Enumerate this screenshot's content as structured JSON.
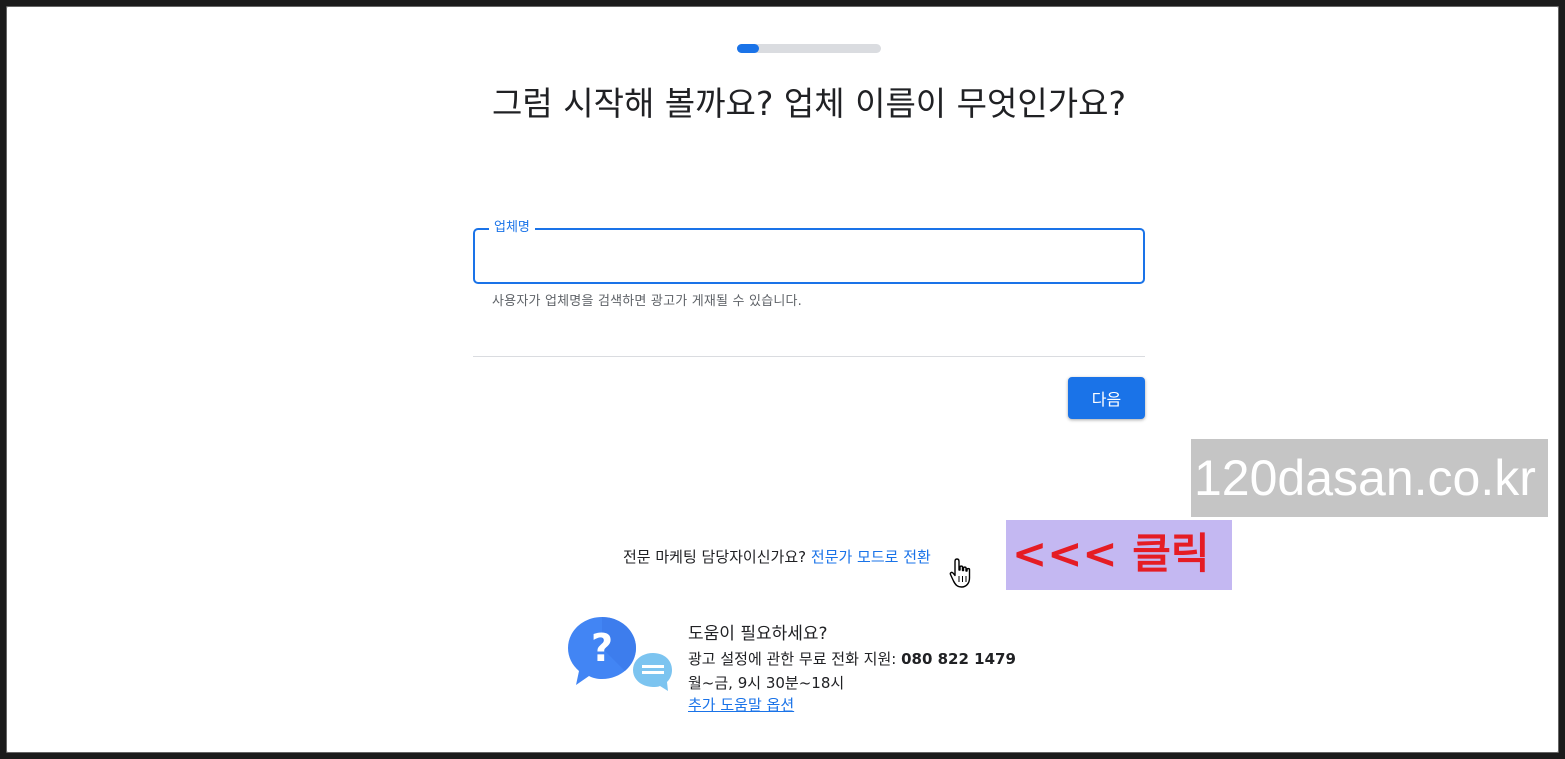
{
  "progress": {
    "fraction": 0.15
  },
  "title": "그럼 시작해 볼까요? 업체 이름이 무엇인가요?",
  "business_field": {
    "label": "업체명",
    "value": "",
    "helper": "사용자가 업체명을 검색하면 광고가 게재될 수 있습니다."
  },
  "next_button": "다음",
  "watermark": "120dasan.co.kr",
  "expert": {
    "question": "전문 마케팅 담당자이신가요?",
    "link": "전문가 모드로 전환"
  },
  "annotation": "<<< 클릭",
  "help": {
    "title": "도움이 필요하세요?",
    "phone_prefix": "광고 설정에 관한 무료 전화 지원:",
    "phone": "080 822 1479",
    "hours": "월~금, 9시 30분~18시",
    "more_link": "추가 도움말 옵션"
  },
  "colors": {
    "accent": "#1a73e8",
    "annotation_bg": "#c4b8f2",
    "annotation_text": "#e51c24"
  },
  "icons": [
    "help-bubble-icon",
    "hand-pointer-icon"
  ]
}
